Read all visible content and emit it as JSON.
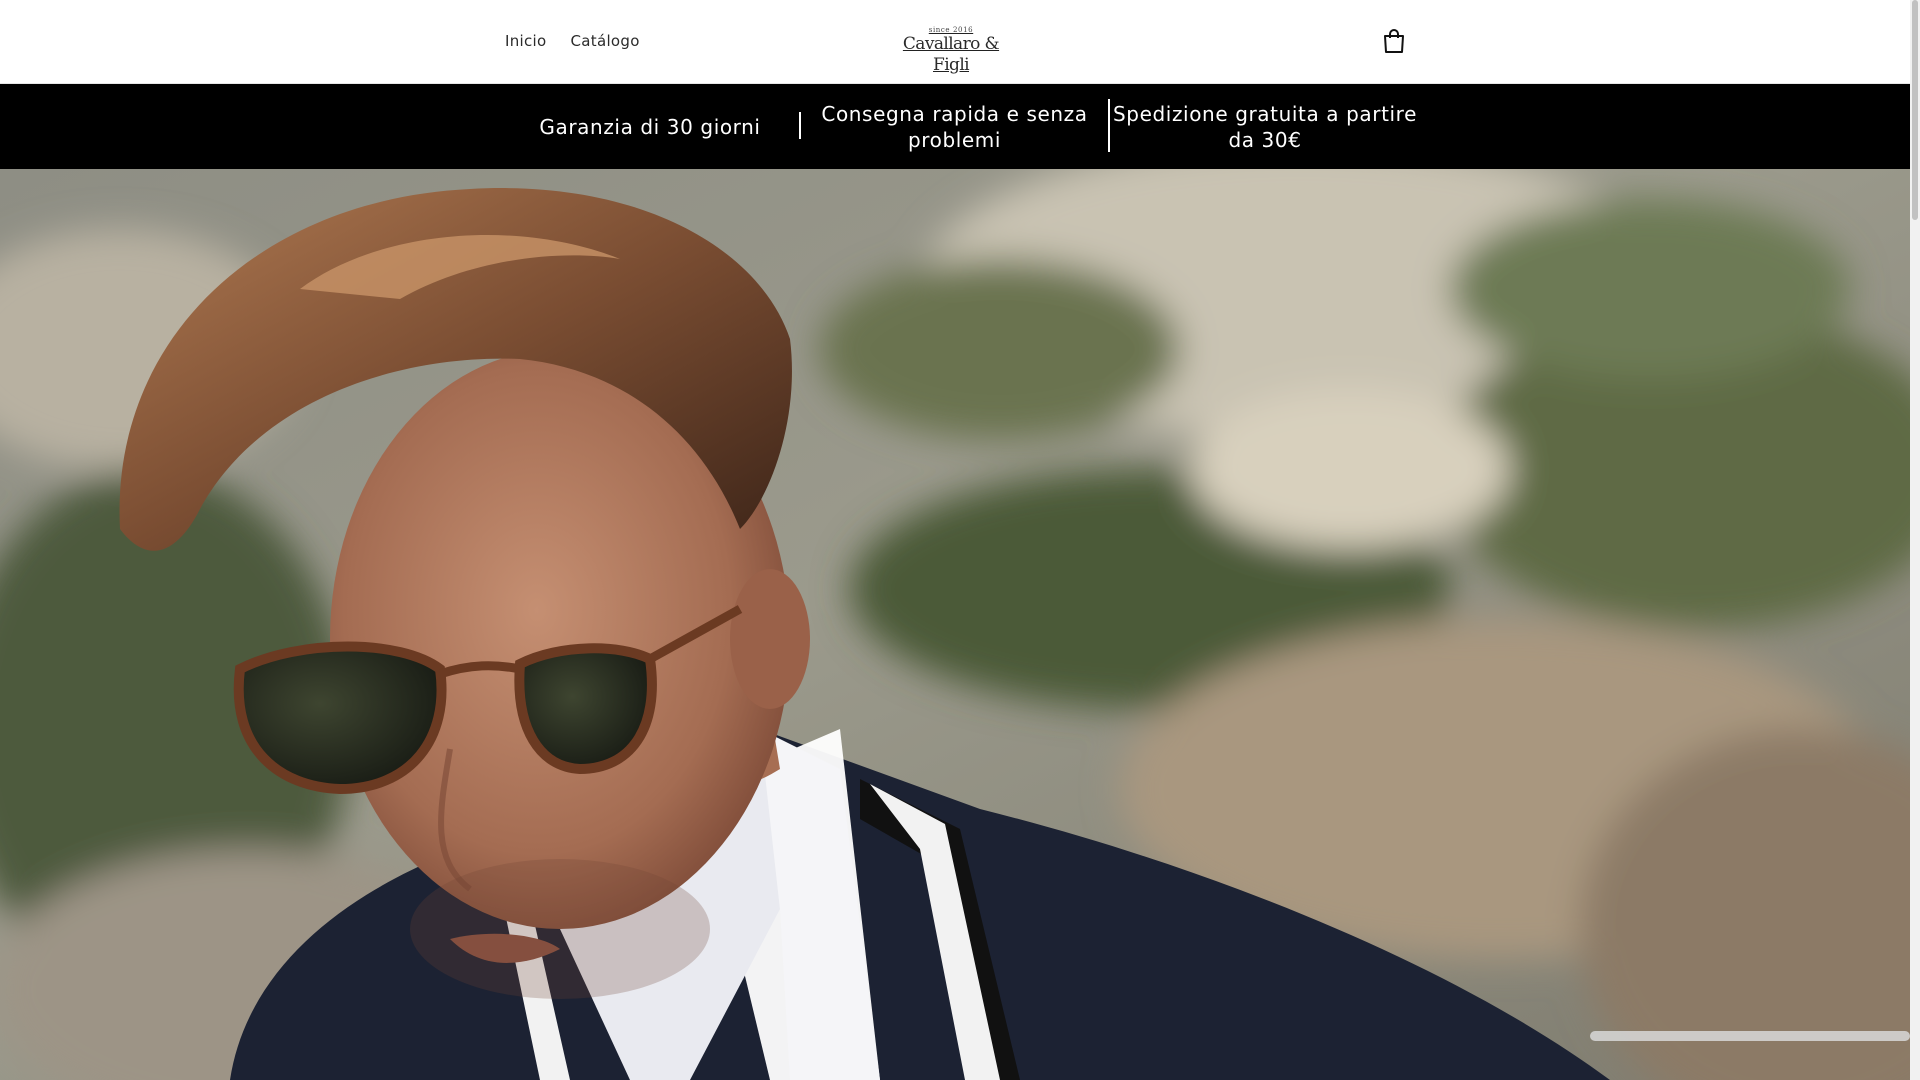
{
  "header": {
    "nav": [
      {
        "label": "Inicio"
      },
      {
        "label": "Catálogo"
      }
    ],
    "logo": {
      "since": "since 2016",
      "brand": "Cavallaro & Figli"
    },
    "cart_icon": "shopping-bag-icon"
  },
  "usp_bar": {
    "items": [
      {
        "text": "Garanzia di 30 giorni"
      },
      {
        "text": "Consegna rapida e senza problemi"
      },
      {
        "text": "Spedizione gratuita a partire da 30€"
      }
    ]
  },
  "hero": {
    "image_alt": ""
  },
  "colors": {
    "header_bg": "#ffffff",
    "usp_bar_bg": "#000000",
    "usp_text": "#ffffff",
    "nav_text": "#2b2b2b"
  }
}
